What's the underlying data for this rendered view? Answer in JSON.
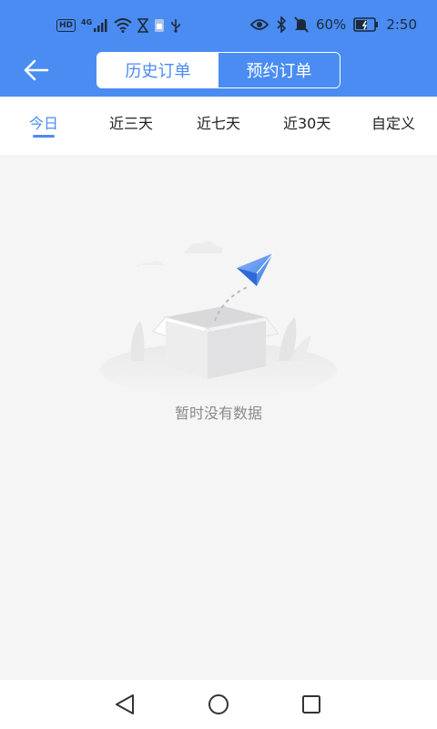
{
  "status_bar": {
    "network_badge": "HD",
    "signal_label": "4G",
    "battery_percent": "60%",
    "time": "2:50",
    "icons": [
      "hd-icon",
      "signal-icon",
      "wifi-icon",
      "hourglass-icon",
      "sim-icon",
      "usb-icon",
      "eye-icon",
      "bluetooth-icon",
      "mute-icon",
      "battery-icon"
    ]
  },
  "header": {
    "back_icon": "arrow-left-icon",
    "tabs": [
      {
        "label": "历史订单",
        "active": true
      },
      {
        "label": "预约订单",
        "active": false
      }
    ]
  },
  "filters": {
    "items": [
      {
        "label": "今日",
        "active": true
      },
      {
        "label": "近三天",
        "active": false
      },
      {
        "label": "近七天",
        "active": false
      },
      {
        "label": "近30天",
        "active": false
      },
      {
        "label": "自定义",
        "active": false
      }
    ]
  },
  "empty_state": {
    "icon": "empty-box-paper-plane-icon",
    "message": "暂时没有数据"
  },
  "nav_bar": {
    "icons": [
      "back-triangle-icon",
      "home-circle-icon",
      "recents-square-icon"
    ]
  },
  "colors": {
    "primary": "#4a8cf2",
    "background": "#f5f5f5",
    "surface": "#ffffff",
    "muted_text": "#8a8a8a"
  }
}
